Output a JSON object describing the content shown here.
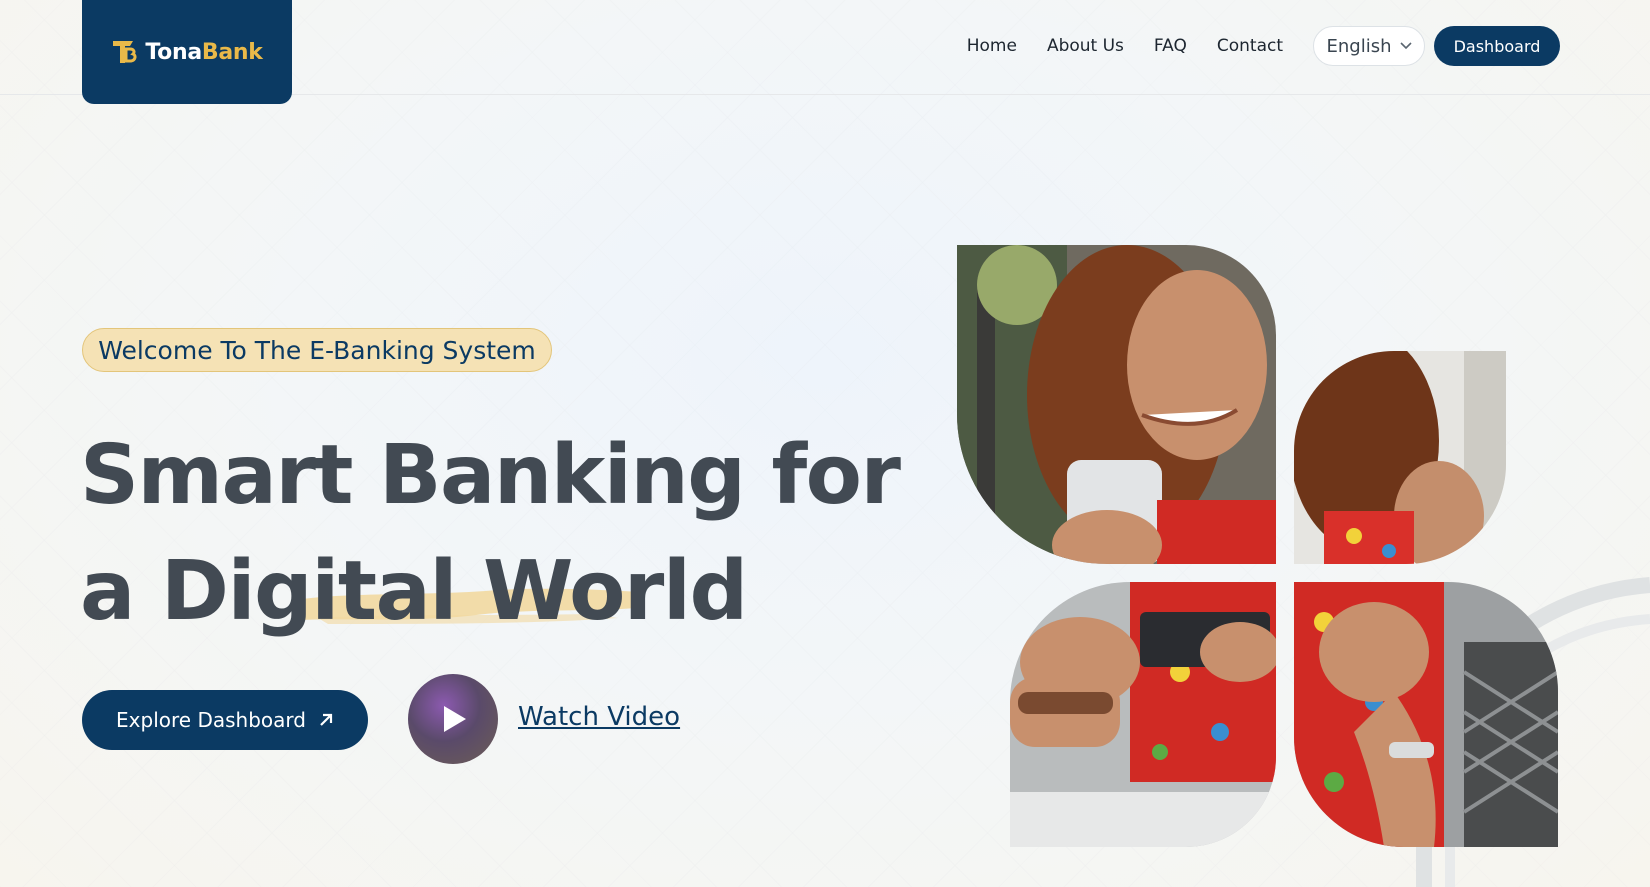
{
  "brand": {
    "name_part1": "Tona",
    "name_part2": "Bank",
    "primary_color": "#0b3a63",
    "accent_color": "#e9b949"
  },
  "nav": {
    "links": [
      "Home",
      "About Us",
      "FAQ",
      "Contact"
    ],
    "language": "English",
    "dashboard_label": "Dashboard"
  },
  "hero": {
    "badge": "Welcome To The E-Banking System",
    "headline_line1": "Smart Banking for",
    "headline_line2": "a Digital World",
    "explore_label": "Explore Dashboard",
    "watch_label": "Watch Video"
  },
  "icons": {
    "logo": "tonabank-logo-icon",
    "language_chevron": "chevron-down-icon",
    "explore_arrow": "arrow-up-right-icon",
    "play": "play-icon"
  }
}
